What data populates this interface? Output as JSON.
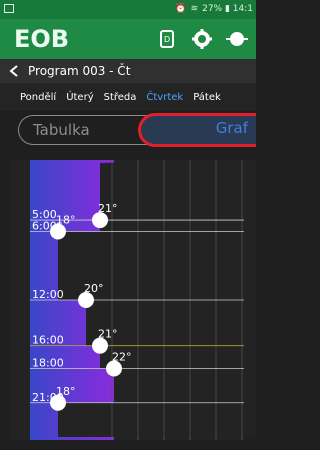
{
  "status_bar": {
    "right_text": "27% ▮ 14:1"
  },
  "app_bar": {
    "logo_text": "EOB"
  },
  "title_bar": {
    "title": "Program 003 - Čt"
  },
  "days": [
    "Pondělí",
    "Úterý",
    "Středa",
    "Čtvrtek",
    "Pátek"
  ],
  "active_day": "Čtvrtek",
  "segments": {
    "table": "Tabulka",
    "graph": "Graf"
  },
  "colors": {
    "accent": "#1f8a44",
    "selected": "#4aa3ff",
    "highlight": "#e0202a"
  },
  "chart_data": {
    "type": "line",
    "x_label": "",
    "y_label": "",
    "points": [
      {
        "time": "5:00",
        "temp": "21°"
      },
      {
        "time": "6:00",
        "temp": "18°"
      },
      {
        "time": "12:00",
        "temp": "20°"
      },
      {
        "time": "16:00",
        "temp": "21°"
      },
      {
        "time": "18:00",
        "temp": "22°"
      },
      {
        "time": "21:00",
        "temp": "18°"
      }
    ],
    "time_labels": [
      "5:00",
      "6:00",
      "12:00",
      "16:00",
      "18:00",
      "21:00"
    ],
    "temp_labels": [
      "21°",
      "18°",
      "20°",
      "21°",
      "22°",
      "18°"
    ],
    "hours_ticks": [
      5,
      6,
      12,
      16,
      18,
      21
    ],
    "values": [
      21,
      18,
      20,
      21,
      22,
      18
    ]
  }
}
